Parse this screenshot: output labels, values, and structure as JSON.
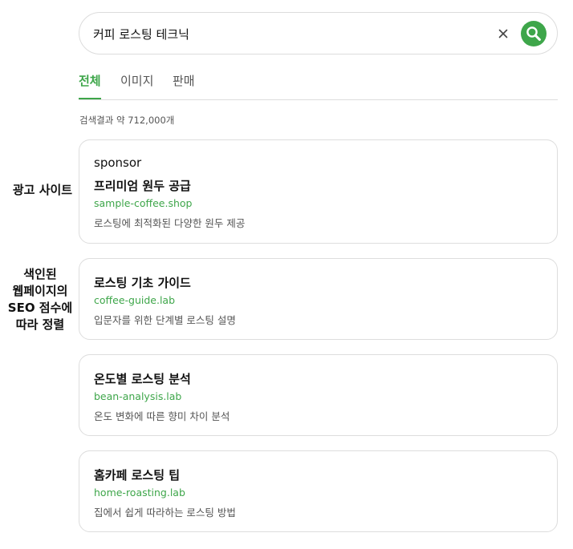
{
  "search": {
    "query": "커피 로스팅 테크닉"
  },
  "tabs": [
    {
      "label": "전체",
      "active": true
    },
    {
      "label": "이미지",
      "active": false
    },
    {
      "label": "판매",
      "active": false
    }
  ],
  "result_count": "검색결과 약 712,000개",
  "side_labels": {
    "ad": "광고 사이트",
    "seo": [
      "색인된",
      "웹페이지의",
      "SEO 점수에",
      "따라 정렬"
    ]
  },
  "ad_result": {
    "sponsor": "sponsor",
    "title": "프리미엄 원두 공급",
    "url": "sample-coffee.shop",
    "description": "로스팅에 최적화된 다양한 원두 제공"
  },
  "results": [
    {
      "title": "로스팅 기초 가이드",
      "url": "coffee-guide.lab",
      "description": "입문자를 위한 단계별 로스팅 설명"
    },
    {
      "title": "온도별 로스팅 분석",
      "url": "bean-analysis.lab",
      "description": "온도 변화에 따른 향미 차이 분석"
    },
    {
      "title": "홈카페 로스팅 팁",
      "url": "home-roasting.lab",
      "description": "집에서 쉽게 따라하는 로스팅 방법"
    }
  ],
  "colors": {
    "accent": "#3ea64a",
    "border": "#dddddd",
    "muted_text": "#555555"
  },
  "icons": {
    "clear": "close-icon",
    "search": "search-icon"
  }
}
